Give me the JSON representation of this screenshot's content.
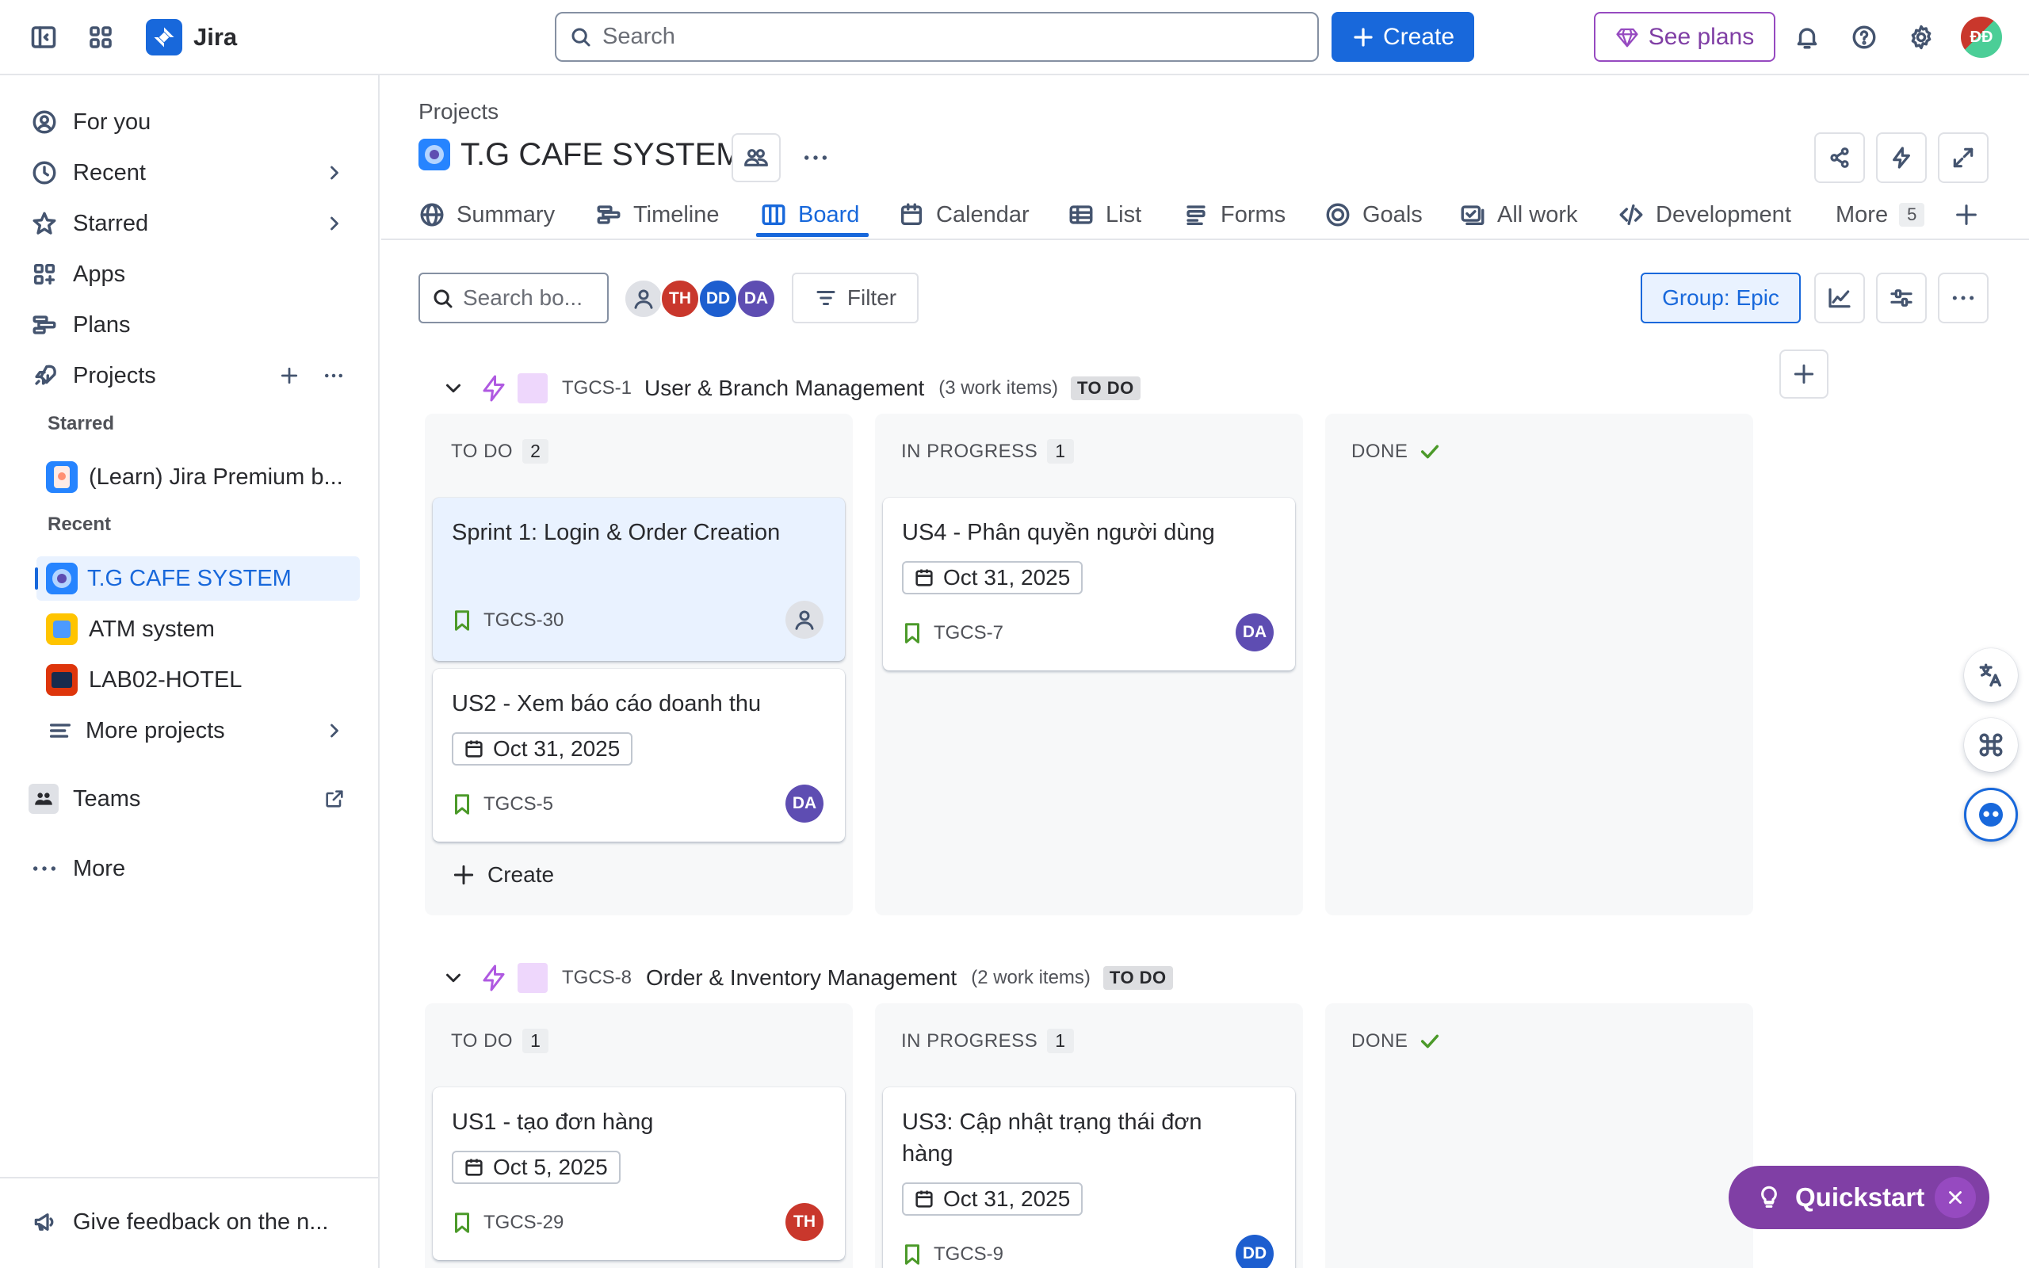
{
  "app": {
    "name": "Jira"
  },
  "topbar": {
    "search_placeholder": "Search",
    "create_label": "Create",
    "see_plans_label": "See plans",
    "avatar_initials": "ĐĐ"
  },
  "sidebar": {
    "items": [
      {
        "label": "For you"
      },
      {
        "label": "Recent"
      },
      {
        "label": "Starred"
      },
      {
        "label": "Apps"
      },
      {
        "label": "Plans"
      },
      {
        "label": "Projects"
      }
    ],
    "starred_label": "Starred",
    "starred_projects": [
      {
        "label": "(Learn) Jira Premium b..."
      }
    ],
    "recent_label": "Recent",
    "recent_projects": [
      {
        "label": "T.G CAFE SYSTEM"
      },
      {
        "label": "ATM system"
      },
      {
        "label": "LAB02-HOTEL"
      }
    ],
    "more_projects_label": "More projects",
    "teams_label": "Teams",
    "more_label": "More",
    "feedback_label": "Give feedback on the n..."
  },
  "project": {
    "breadcrumb": "Projects",
    "title": "T.G CAFE SYSTEM"
  },
  "tabs": [
    {
      "label": "Summary"
    },
    {
      "label": "Timeline"
    },
    {
      "label": "Board"
    },
    {
      "label": "Calendar"
    },
    {
      "label": "List"
    },
    {
      "label": "Forms"
    },
    {
      "label": "Goals"
    },
    {
      "label": "All work"
    },
    {
      "label": "Development"
    },
    {
      "label": "More",
      "count": "5"
    }
  ],
  "toolbar": {
    "search_placeholder": "Search bo...",
    "avatars": [
      "TH",
      "DD",
      "DA"
    ],
    "filter_label": "Filter",
    "group_label": "Group: Epic"
  },
  "epics": [
    {
      "key": "TGCS-1",
      "title": "User & Branch Management",
      "count": "(3 work items)",
      "status": "TO DO",
      "columns": [
        {
          "name": "TO DO",
          "count": "2"
        },
        {
          "name": "IN PROGRESS",
          "count": "1"
        },
        {
          "name": "DONE"
        }
      ],
      "cards": [
        {
          "title": "Sprint 1: Login & Order Creation",
          "key": "TGCS-30"
        },
        {
          "title": "US2 - Xem báo cáo doanh thu",
          "date": "Oct 31, 2025",
          "key": "TGCS-5",
          "assignee": "DA"
        },
        {
          "title": "US4 - Phân quyền người dùng",
          "date": "Oct 31, 2025",
          "key": "TGCS-7",
          "assignee": "DA"
        }
      ],
      "create_label": "Create"
    },
    {
      "key": "TGCS-8",
      "title": "Order & Inventory Management",
      "count": "(2 work items)",
      "status": "TO DO",
      "columns": [
        {
          "name": "TO DO",
          "count": "1"
        },
        {
          "name": "IN PROGRESS",
          "count": "1"
        },
        {
          "name": "DONE"
        }
      ],
      "cards": [
        {
          "title": "US1 - tạo đơn hàng",
          "date": "Oct 5, 2025",
          "key": "TGCS-29",
          "assignee": "TH"
        },
        {
          "title": "US3: Cập nhật trạng thái đơn hàng",
          "date": "Oct 31, 2025",
          "key": "TGCS-9",
          "assignee": "DD"
        }
      ]
    }
  ],
  "quickstart": {
    "label": "Quickstart"
  },
  "colors": {
    "brand": "#1868db",
    "purple": "#803fa5",
    "th": "#c9372c",
    "dd": "#1d5ecf",
    "da": "#5e4db2"
  }
}
